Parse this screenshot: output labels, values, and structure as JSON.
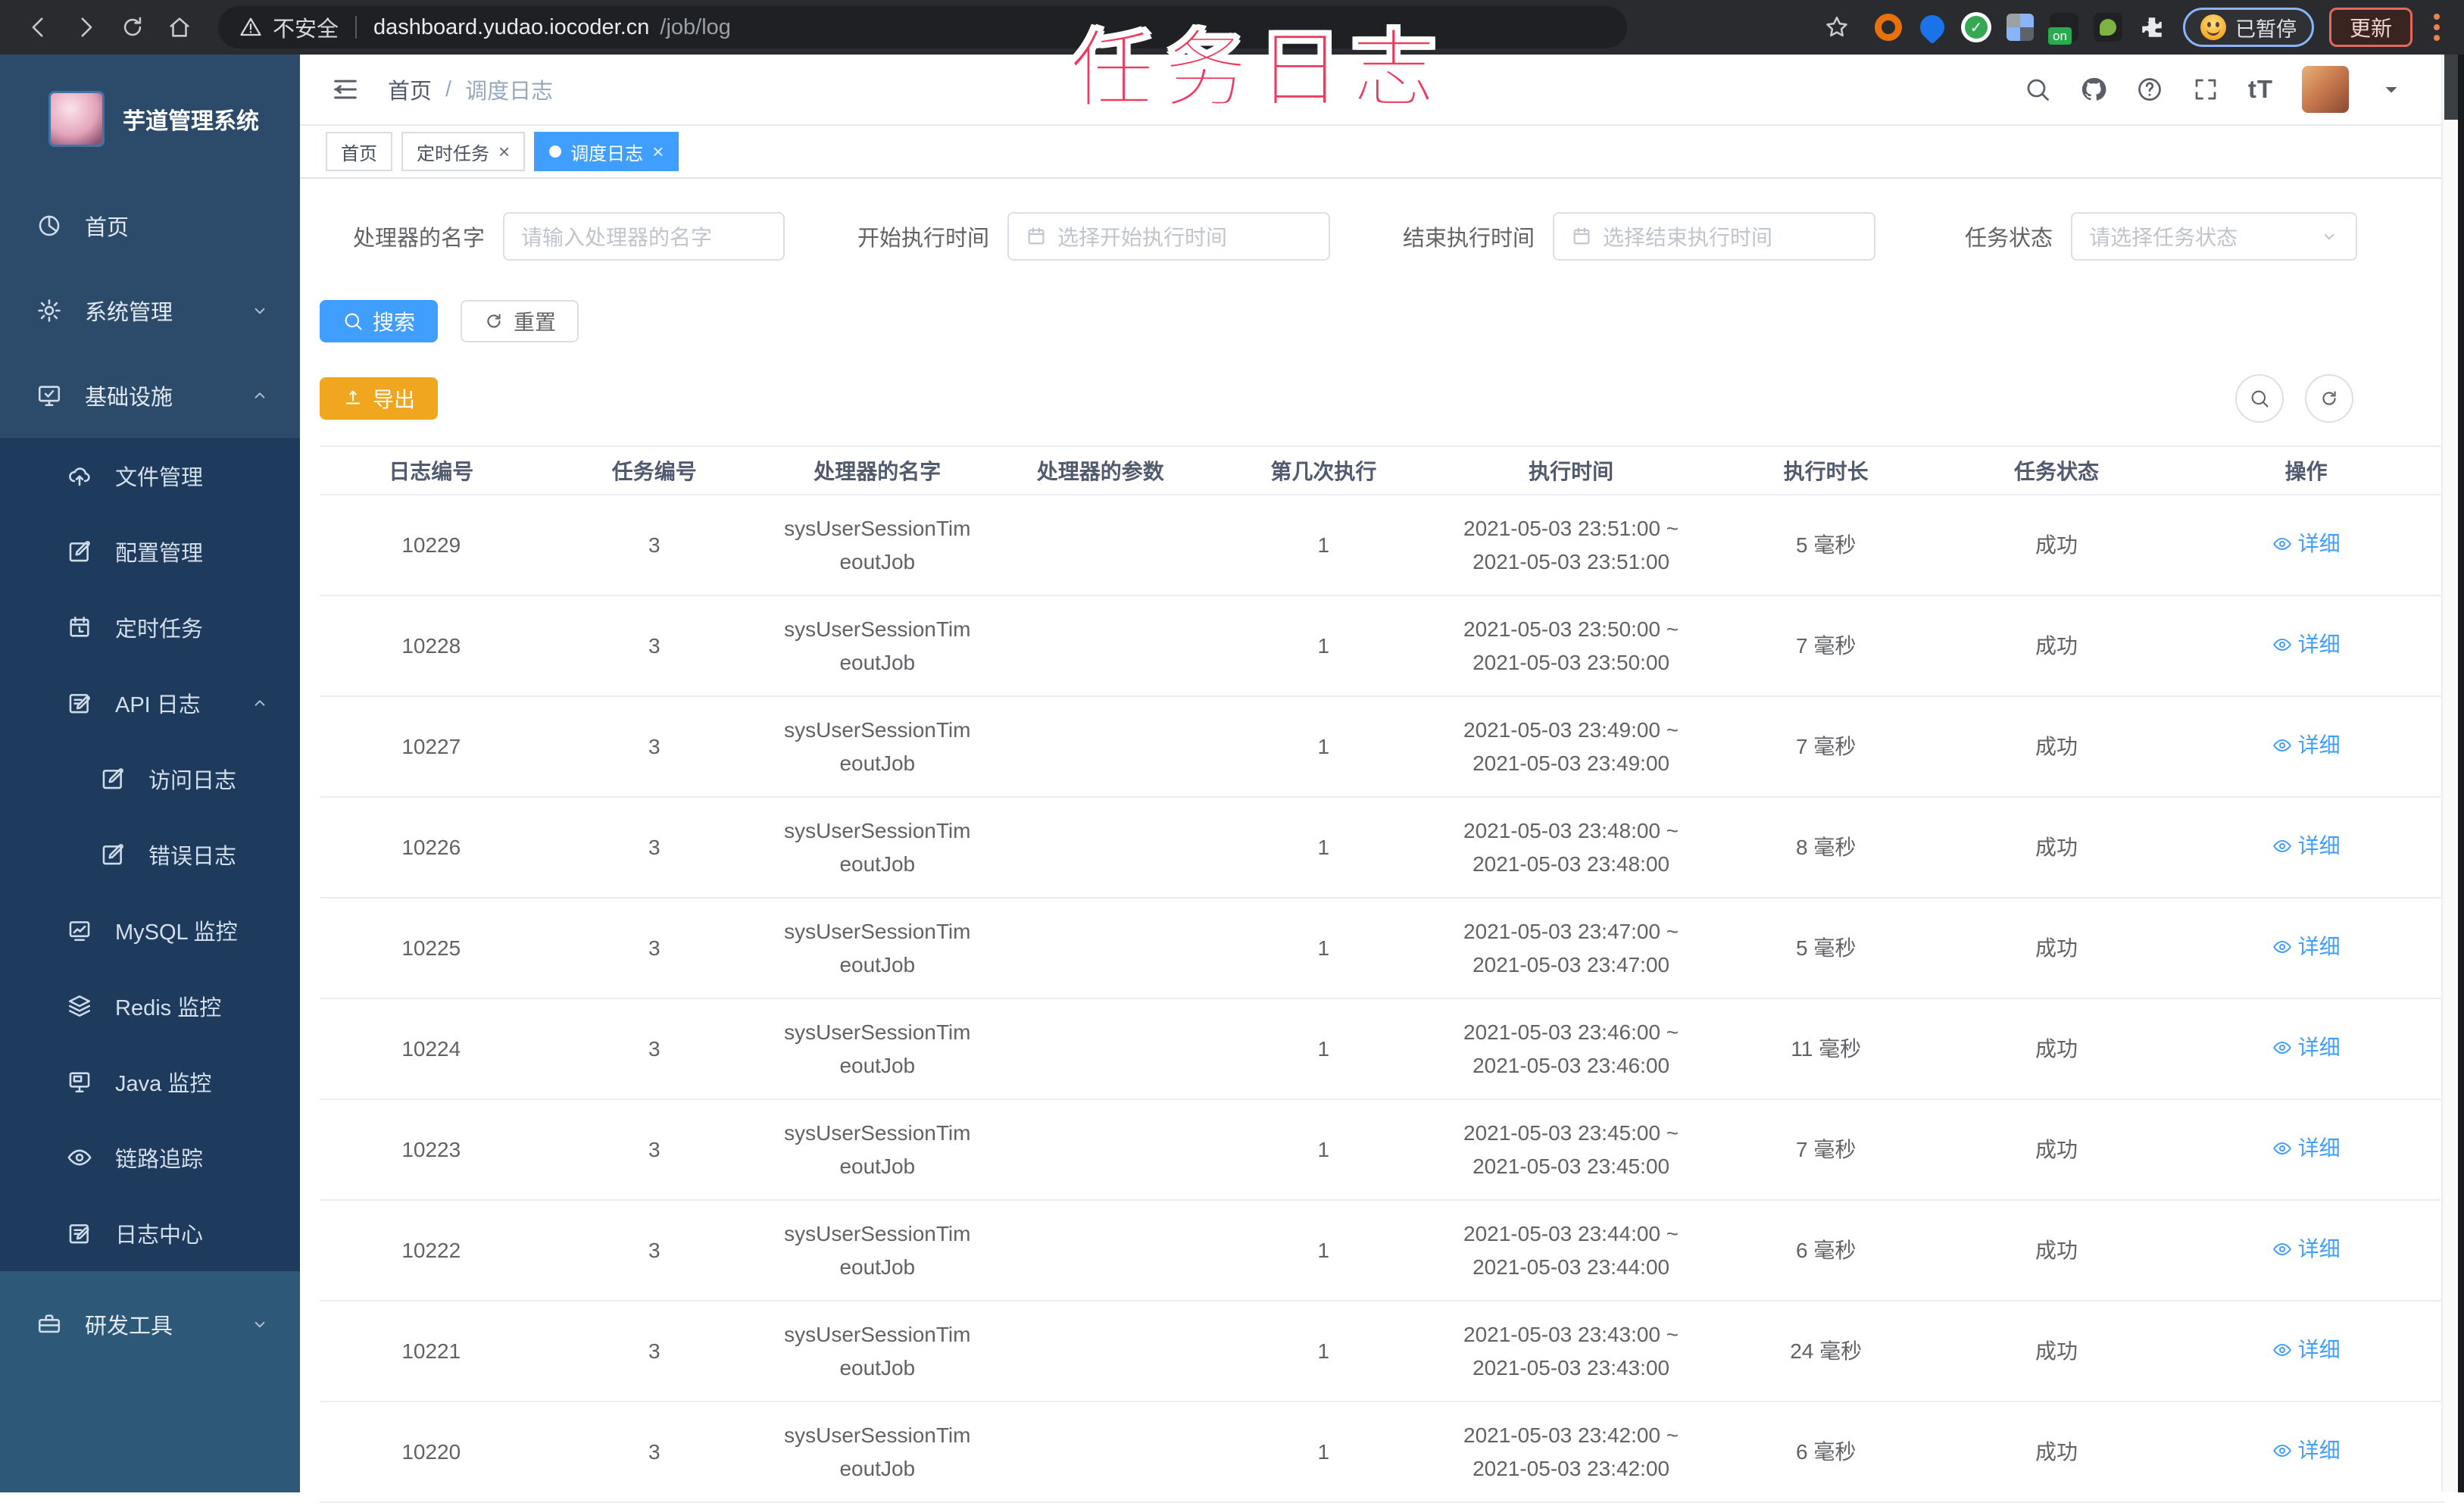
{
  "browser": {
    "security_label": "不安全",
    "url_host": "dashboard.yudao.iocoder.cn",
    "url_path": "/job/log",
    "on_badge": "on",
    "paused_label": "已暂停",
    "update_label": "更新",
    "extension_icons": [
      "ring-extension-icon",
      "pin-extension-icon",
      "check-extension-icon",
      "grid-extension-icon",
      "onoff-extension-icon",
      "leaf-extension-icon",
      "puzzle-extension-icon"
    ]
  },
  "overlay": {
    "title": "任务日志"
  },
  "sidebar": {
    "app_title": "芋道管理系统",
    "menu": [
      {
        "icon": "dashboard-icon",
        "label": "首页",
        "section": "top",
        "chevron": ""
      },
      {
        "icon": "gear-icon",
        "label": "系统管理",
        "section": "top",
        "chevron": "down"
      },
      {
        "icon": "infra-monitor-icon",
        "label": "基础设施",
        "section": "top",
        "chevron": "up"
      },
      {
        "icon": "cloud-upload-icon",
        "label": "文件管理",
        "section": "sub",
        "chevron": ""
      },
      {
        "icon": "edit-square-icon",
        "label": "配置管理",
        "section": "sub",
        "chevron": ""
      },
      {
        "icon": "timer-icon",
        "label": "定时任务",
        "section": "sub",
        "chevron": ""
      },
      {
        "icon": "api-log-icon",
        "label": "API 日志",
        "section": "sub",
        "chevron": "up"
      },
      {
        "icon": "access-log-icon",
        "label": "访问日志",
        "section": "nested",
        "chevron": ""
      },
      {
        "icon": "error-log-icon",
        "label": "错误日志",
        "section": "nested",
        "chevron": ""
      },
      {
        "icon": "mysql-monitor-icon",
        "label": "MySQL 监控",
        "section": "sub",
        "chevron": ""
      },
      {
        "icon": "redis-monitor-icon",
        "label": "Redis 监控",
        "section": "sub",
        "chevron": ""
      },
      {
        "icon": "java-monitor-icon",
        "label": "Java 监控",
        "section": "sub",
        "chevron": ""
      },
      {
        "icon": "trace-eye-icon",
        "label": "链路追踪",
        "section": "sub",
        "chevron": ""
      },
      {
        "icon": "log-center-icon",
        "label": "日志中心",
        "section": "sub",
        "chevron": ""
      },
      {
        "icon": "toolbox-icon",
        "label": "研发工具",
        "section": "bottom",
        "chevron": "down"
      }
    ]
  },
  "header": {
    "breadcrumb_home": "首页",
    "breadcrumb_separator": "/",
    "breadcrumb_current": "调度日志"
  },
  "tags": [
    {
      "label": "首页",
      "active": false,
      "closable": false
    },
    {
      "label": "定时任务",
      "active": false,
      "closable": true
    },
    {
      "label": "调度日志",
      "active": true,
      "closable": true
    }
  ],
  "filters": [
    {
      "label": "处理器的名字",
      "placeholder": "请输入处理器的名字",
      "type": "text"
    },
    {
      "label": "开始执行时间",
      "placeholder": "选择开始执行时间",
      "type": "date"
    },
    {
      "label": "结束执行时间",
      "placeholder": "选择结束执行时间",
      "type": "date"
    },
    {
      "label": "任务状态",
      "placeholder": "请选择任务状态",
      "type": "select"
    }
  ],
  "toolbar": {
    "search_label": "搜索",
    "reset_label": "重置",
    "export_label": "导出"
  },
  "table": {
    "headers": [
      "日志编号",
      "任务编号",
      "处理器的名字",
      "处理器的参数",
      "第几次执行",
      "执行时间",
      "执行时长",
      "任务状态",
      "操作"
    ],
    "detail_label": "详细",
    "time_separator": "~",
    "rows": [
      {
        "log_id": "10229",
        "task_id": "3",
        "handler_name": "sysUserSessionTimeoutJob",
        "handler_param": "",
        "execute_index": "1",
        "begin_time": "2021-05-03 23:51:00",
        "end_time": "2021-05-03 23:51:00",
        "duration": "5 毫秒",
        "status": "成功"
      },
      {
        "log_id": "10228",
        "task_id": "3",
        "handler_name": "sysUserSessionTimeoutJob",
        "handler_param": "",
        "execute_index": "1",
        "begin_time": "2021-05-03 23:50:00",
        "end_time": "2021-05-03 23:50:00",
        "duration": "7 毫秒",
        "status": "成功"
      },
      {
        "log_id": "10227",
        "task_id": "3",
        "handler_name": "sysUserSessionTimeoutJob",
        "handler_param": "",
        "execute_index": "1",
        "begin_time": "2021-05-03 23:49:00",
        "end_time": "2021-05-03 23:49:00",
        "duration": "7 毫秒",
        "status": "成功"
      },
      {
        "log_id": "10226",
        "task_id": "3",
        "handler_name": "sysUserSessionTimeoutJob",
        "handler_param": "",
        "execute_index": "1",
        "begin_time": "2021-05-03 23:48:00",
        "end_time": "2021-05-03 23:48:00",
        "duration": "8 毫秒",
        "status": "成功"
      },
      {
        "log_id": "10225",
        "task_id": "3",
        "handler_name": "sysUserSessionTimeoutJob",
        "handler_param": "",
        "execute_index": "1",
        "begin_time": "2021-05-03 23:47:00",
        "end_time": "2021-05-03 23:47:00",
        "duration": "5 毫秒",
        "status": "成功"
      },
      {
        "log_id": "10224",
        "task_id": "3",
        "handler_name": "sysUserSessionTimeoutJob",
        "handler_param": "",
        "execute_index": "1",
        "begin_time": "2021-05-03 23:46:00",
        "end_time": "2021-05-03 23:46:00",
        "duration": "11 毫秒",
        "status": "成功"
      },
      {
        "log_id": "10223",
        "task_id": "3",
        "handler_name": "sysUserSessionTimeoutJob",
        "handler_param": "",
        "execute_index": "1",
        "begin_time": "2021-05-03 23:45:00",
        "end_time": "2021-05-03 23:45:00",
        "duration": "7 毫秒",
        "status": "成功"
      },
      {
        "log_id": "10222",
        "task_id": "3",
        "handler_name": "sysUserSessionTimeoutJob",
        "handler_param": "",
        "execute_index": "1",
        "begin_time": "2021-05-03 23:44:00",
        "end_time": "2021-05-03 23:44:00",
        "duration": "6 毫秒",
        "status": "成功"
      },
      {
        "log_id": "10221",
        "task_id": "3",
        "handler_name": "sysUserSessionTimeoutJob",
        "handler_param": "",
        "execute_index": "1",
        "begin_time": "2021-05-03 23:43:00",
        "end_time": "2021-05-03 23:43:00",
        "duration": "24 毫秒",
        "status": "成功"
      },
      {
        "log_id": "10220",
        "task_id": "3",
        "handler_name": "sysUserSessionTimeoutJob",
        "handler_param": "",
        "execute_index": "1",
        "begin_time": "2021-05-03 23:42:00",
        "end_time": "2021-05-03 23:42:00",
        "duration": "6 毫秒",
        "status": "成功"
      }
    ]
  },
  "colors": {
    "accent": "#409eff",
    "export_button": "#f0a71f",
    "overlay_title": "#ef3a5e",
    "sidebar_top": "#2c4b6b",
    "sidebar_sub": "#1e3a5c",
    "sidebar_bottom": "#2d5878"
  }
}
